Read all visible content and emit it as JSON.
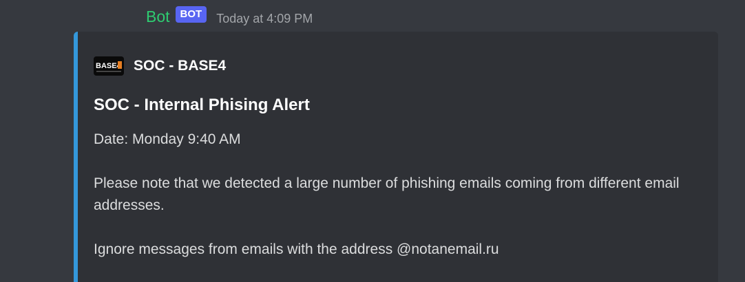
{
  "message": {
    "username": "Bot",
    "bot_tag": "BOT",
    "timestamp": "Today at 4:09 PM"
  },
  "embed": {
    "accent_color": "#3498db",
    "author": {
      "icon": "base4-logo-icon",
      "icon_text": "BASE4",
      "name": "SOC - BASE4"
    },
    "title": "SOC - Internal Phising Alert",
    "description": {
      "date_line": "Date: Monday 9:40 AM",
      "paragraph_1": "Please note that we detected a large number of phishing emails coming from different email addresses.",
      "paragraph_2": "Ignore messages from emails with the address @notanemail.ru"
    }
  },
  "colors": {
    "background": "#36393f",
    "embed_background": "#2f3136",
    "username": "#2ecc71",
    "bot_tag": "#5865f2"
  }
}
